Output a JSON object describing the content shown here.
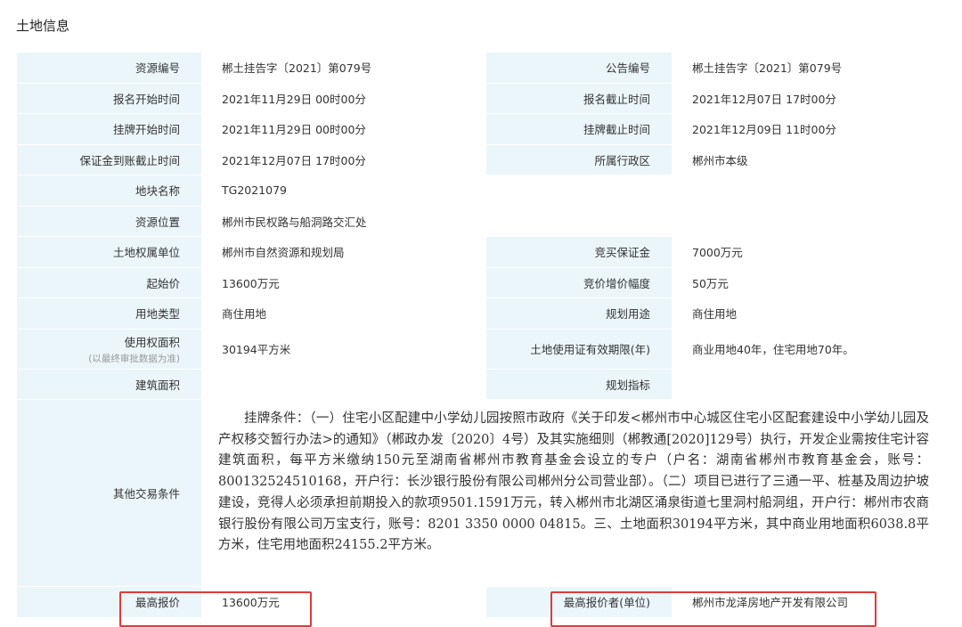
{
  "section_title": "土地信息",
  "rows": {
    "resource_no": {
      "label": "资源编号",
      "value": "郴土挂告字〔2021〕第079号"
    },
    "notice_no": {
      "label": "公告编号",
      "value": "郴土挂告字〔2021〕第079号"
    },
    "signup_start": {
      "label": "报名开始时间",
      "value": "2021年11月29日 00时00分"
    },
    "signup_end": {
      "label": "报名截止时间",
      "value": "2021年12月07日 17时00分"
    },
    "listing_start": {
      "label": "挂牌开始时间",
      "value": "2021年11月29日 00时00分"
    },
    "listing_end": {
      "label": "挂牌截止时间",
      "value": "2021年12月09日 11时00分"
    },
    "deposit_deadline": {
      "label": "保证金到账截止时间",
      "value": "2021年12月07日 17时00分"
    },
    "district": {
      "label": "所属行政区",
      "value": "郴州市本级"
    },
    "plot_name": {
      "label": "地块名称",
      "value": "TG2021079"
    },
    "location": {
      "label": "资源位置",
      "value": "郴州市民权路与船洞路交汇处"
    },
    "owner": {
      "label": "土地权属单位",
      "value": "郴州市自然资源和规划局"
    },
    "deposit": {
      "label": "竞买保证金",
      "value": "7000万元"
    },
    "start_price": {
      "label": "起始价",
      "value": "13600万元"
    },
    "increment": {
      "label": "竞价增价幅度",
      "value": "50万元"
    },
    "land_type": {
      "label": "用地类型",
      "value": "商住用地"
    },
    "planned_use": {
      "label": "规划用途",
      "value": "商住用地"
    },
    "area": {
      "label": "使用权面积",
      "sub": "(以最终审批数据为准)",
      "value": "30194平方米"
    },
    "term": {
      "label": "土地使用证有效期限(年)",
      "value": "商业用地40年，住宅用地70年。"
    },
    "building_area": {
      "label": "建筑面积",
      "value": ""
    },
    "planning_index": {
      "label": "规划指标",
      "value": ""
    },
    "other_conditions": {
      "label": "其他交易条件",
      "value": "挂牌条件：（一）住宅小区配建中小学幼儿园按照市政府《关于印发<郴州市中心城区住宅小区配套建设中小学幼儿园及产权移交暂行办法>的通知》（郴政办发〔2020〕4号）及其实施细则（郴教通[2020]129号）执行，开发企业需按住宅计容建筑面积，每平方米缴纳150元至湖南省郴州市教育基金会设立的专户（户名：湖南省郴州市教育基金会，账号：800132524510168，开户行：长沙银行股份有限公司郴州分公司营业部）。（二）项目已进行了三通一平、桩基及周边护坡建设，竞得人必须承担前期投入的款项9501.1591万元，转入郴州市北湖区涌泉街道七里洞村船洞组，开户行：郴州市农商银行股份有限公司万宝支行，账号：8201 3350 0000 04815。三、土地面积30194平方米，其中商业用地面积6038.8平方米，住宅用地面积24155.2平方米。"
    },
    "highest_price": {
      "label": "最高报价",
      "value": "13600万元"
    },
    "highest_bidder": {
      "label": "最高报价者(单位)",
      "value": "郴州市龙泽房地产开发有限公司"
    }
  },
  "highlight_color": "#e23a3a",
  "label_bg": "#ebf6fb"
}
